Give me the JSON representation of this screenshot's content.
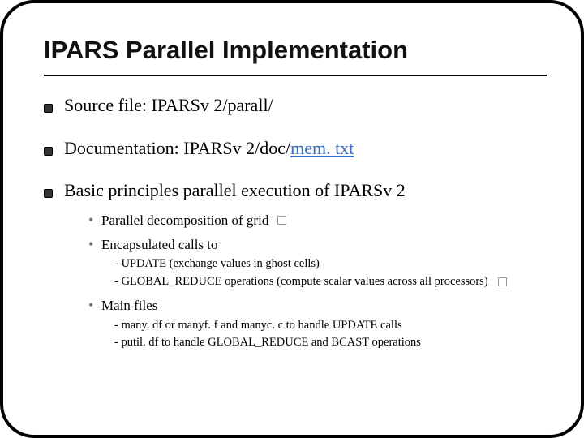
{
  "title": "IPARS Parallel Implementation",
  "bullets": [
    {
      "text": "Source file: IPARSv 2/parall/"
    },
    {
      "prefix": "Documentation: IPARSv 2/doc/",
      "link": "mem. txt"
    },
    {
      "text": "Basic principles parallel execution of IPARSv 2"
    }
  ],
  "sub": {
    "a": "Parallel decomposition of grid",
    "b": "Encapsulated calls to",
    "b1": "- UPDATE (exchange values in ghost cells)",
    "b2": "- GLOBAL_REDUCE operations (compute scalar values across all processors)",
    "c": "Main files",
    "c1": "- many. df or manyf. f and manyc. c to handle UPDATE calls",
    "c2": "- putil. df to handle GLOBAL_REDUCE and BCAST operations"
  }
}
